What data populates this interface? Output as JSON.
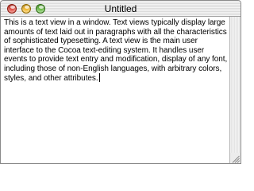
{
  "window": {
    "title": "Untitled"
  },
  "traffic_lights": {
    "close": {
      "color": "#e0463a",
      "icon": "close-button"
    },
    "minimize": {
      "color": "#f2b523",
      "icon": "minimize-button"
    },
    "zoom": {
      "color": "#5fb83a",
      "icon": "zoom-button"
    }
  },
  "text_view": {
    "content": "This is a text view in a window. Text views typically display large amounts of text laid out in paragraphs with all the characteristics of sophisticated typesetting. A text view is the main user interface to the Cocoa text-editing system. It handles user events to provide text entry and modification, display of any font, including those of non-English languages, with arbitrary colors, styles, and other attributes."
  },
  "colors": {
    "window_border": "#8a8a8a",
    "text": "#000000"
  }
}
